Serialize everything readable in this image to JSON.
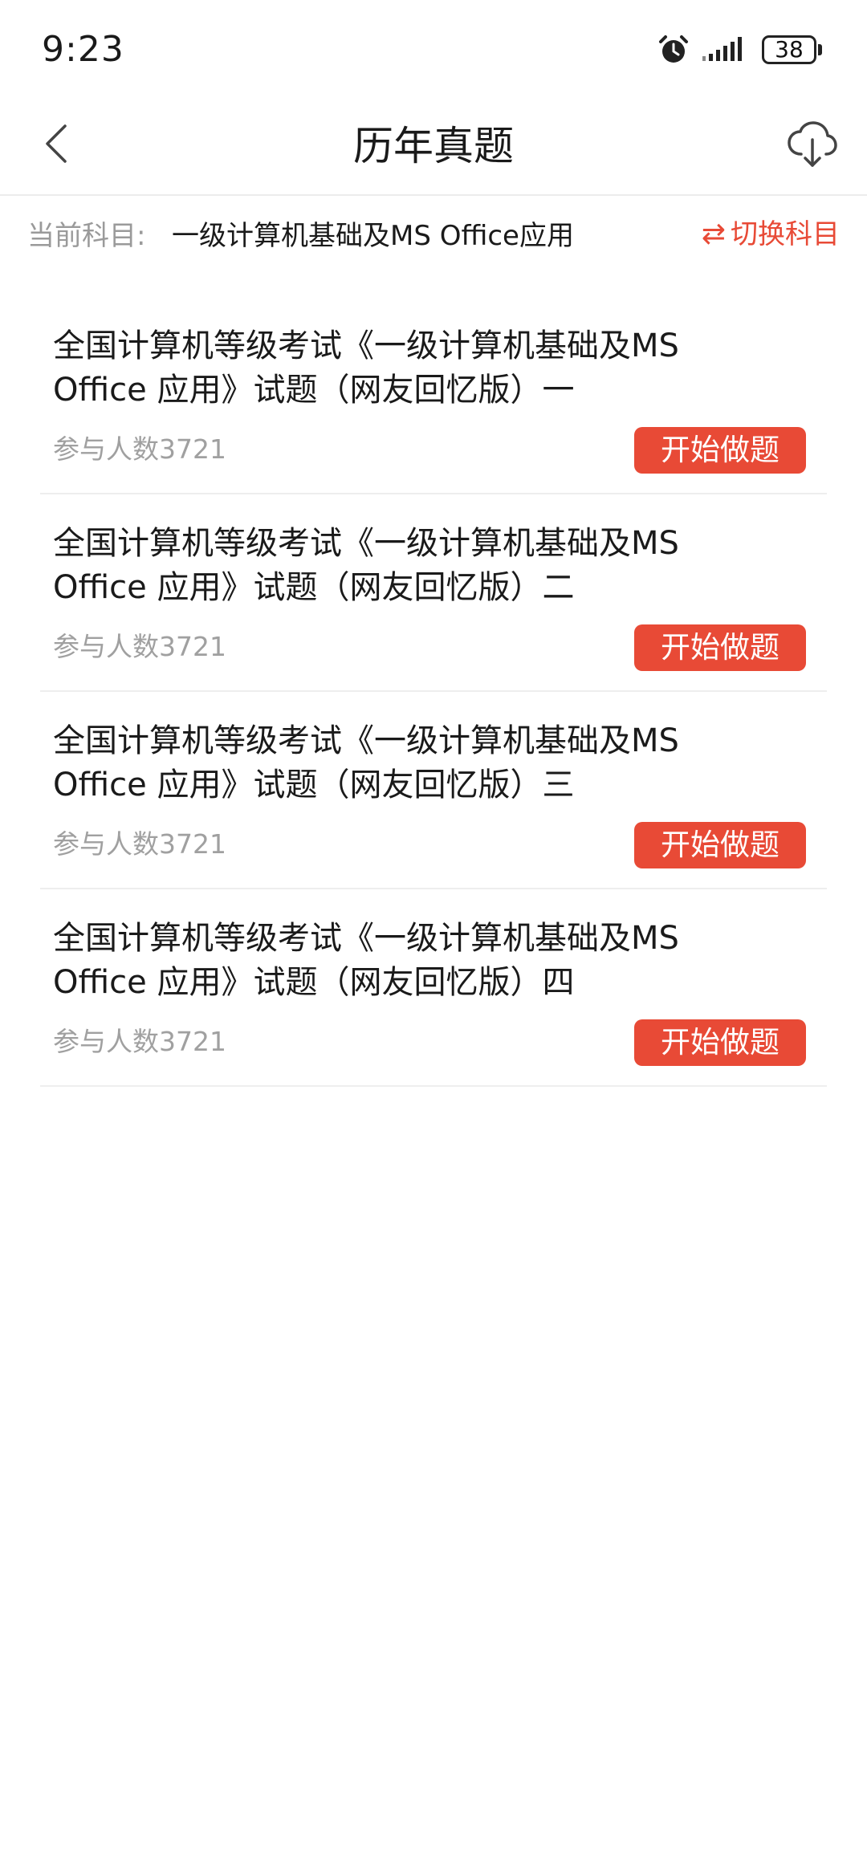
{
  "status_bar": {
    "time": "9:23",
    "battery": "38",
    "icons": [
      "alarm-icon",
      "signal-icon",
      "battery-icon"
    ]
  },
  "header": {
    "title": "历年真题",
    "back_icon": "chevron-left-icon",
    "download_icon": "cloud-download-icon"
  },
  "subject": {
    "label": "当前科目:",
    "value": "一级计算机基础及MS Office应用",
    "switch_icon_glyph": "⇄",
    "switch_label": "切换科目",
    "accent_color": "#e84a36"
  },
  "exams": [
    {
      "title": "全国计算机等级考试《一级计算机基础及MS Office 应用》试题（网友回忆版）一",
      "participants": "参与人数3721",
      "action_label": "开始做题"
    },
    {
      "title": "全国计算机等级考试《一级计算机基础及MS Office 应用》试题（网友回忆版）二",
      "participants": "参与人数3721",
      "action_label": "开始做题"
    },
    {
      "title": "全国计算机等级考试《一级计算机基础及MS Office 应用》试题（网友回忆版）三",
      "participants": "参与人数3721",
      "action_label": "开始做题"
    },
    {
      "title": "全国计算机等级考试《一级计算机基础及MS Office 应用》试题（网友回忆版）四",
      "participants": "参与人数3721",
      "action_label": "开始做题"
    }
  ]
}
